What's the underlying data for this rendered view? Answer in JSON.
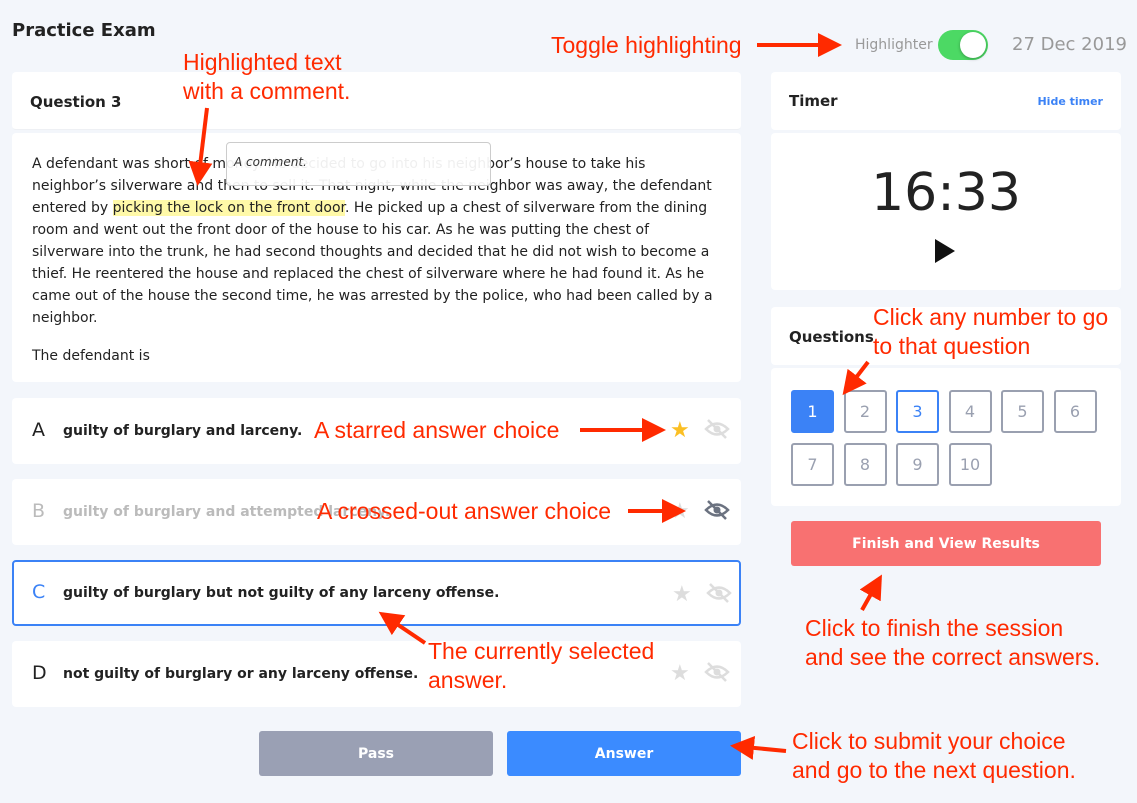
{
  "header": {
    "title": "Practice Exam",
    "highlighter_label": "Highlighter",
    "highlighter_on": true,
    "date": "27 Dec 2019"
  },
  "question": {
    "label": "Question 3",
    "text_before": "A defendant was short of money. He decided to go into his neighbor’s house to take his neighbor’s silverware and then to sell it. That night, while the neighbor was away, the defendant entered by ",
    "highlight": "picking the lock on the front door",
    "text_after": ". He picked up a chest of silverware from the dining room and went out the front door of the house to his car. As he was putting the chest of silverware into the trunk, he had second thoughts and decided that he did not wish to become a thief. He reentered the house and replaced the chest of silverware where he had found it. As he came out of the house the second time, he was arrested by the police, who had been called by a neighbor.",
    "prompt": "The defendant is",
    "comment": "A comment."
  },
  "choices": [
    {
      "letter": "A",
      "text": "guilty of burglary and larceny.",
      "starred": true,
      "crossed": false,
      "selected": false
    },
    {
      "letter": "B",
      "text": "guilty of burglary and attempted larceny.",
      "starred": false,
      "crossed": true,
      "selected": false
    },
    {
      "letter": "C",
      "text": "guilty of burglary but not guilty of any larceny offense.",
      "starred": false,
      "crossed": false,
      "selected": true
    },
    {
      "letter": "D",
      "text": "not guilty of burglary or any larceny offense.",
      "starred": false,
      "crossed": false,
      "selected": false
    }
  ],
  "timer": {
    "title": "Timer",
    "hide_label": "Hide timer",
    "time": "16:33"
  },
  "questions": {
    "title": "Questions",
    "numbers": [
      "1",
      "2",
      "3",
      "4",
      "5",
      "6",
      "7",
      "8",
      "9",
      "10"
    ],
    "answered": "1",
    "current": "3"
  },
  "buttons": {
    "finish": "Finish and View Results",
    "pass": "Pass",
    "answer": "Answer"
  },
  "annotations": {
    "toggle": "Toggle highlighting",
    "highlight_1": "Highlighted text",
    "highlight_2": "with a comment.",
    "number_1": "Click any number to go",
    "number_2": "to that question",
    "starred": "A starred answer choice",
    "crossed": "A crossed-out answer choice",
    "selected_1": "The currently selected",
    "selected_2": "answer.",
    "finish_1": "Click to finish the session",
    "finish_2": "and see the correct answers.",
    "submit_1": "Click to submit your choice",
    "submit_2": "and go to the next question."
  },
  "colors": {
    "accent": "#3b82f6",
    "finish": "#f87171",
    "pass": "#9aa0b4",
    "highlight": "#fff9a8",
    "annotation": "#ff2a00",
    "toggle": "#4cd964"
  }
}
